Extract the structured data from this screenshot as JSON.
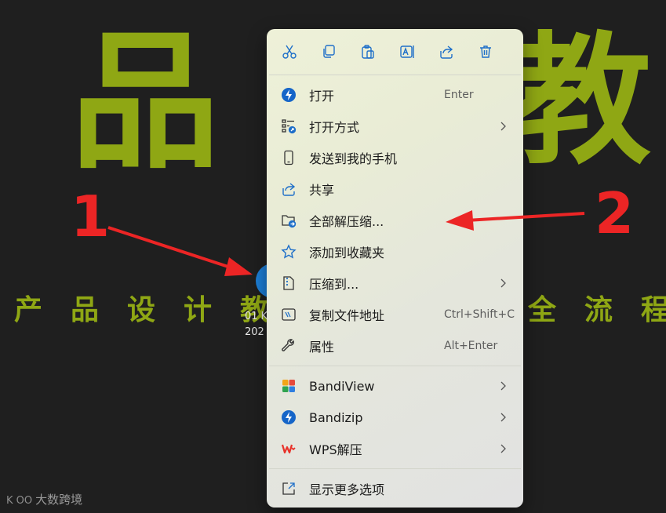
{
  "background": {
    "big_left": "品",
    "big_right": "教",
    "subtitle_left": [
      "产",
      "品",
      "设",
      "计",
      "教"
    ],
    "subtitle_right": [
      "全",
      "流",
      "程"
    ],
    "file_name_line1": "01 K",
    "file_name_line2": "202",
    "num_1": "1",
    "num_2": "2",
    "watermark": "大数跨境",
    "watermark_logo": "K OO"
  },
  "menu": {
    "toolbar": [
      {
        "name": "cut-icon"
      },
      {
        "name": "copy-icon"
      },
      {
        "name": "paste-icon"
      },
      {
        "name": "rename-icon"
      },
      {
        "name": "share-icon"
      },
      {
        "name": "delete-icon"
      }
    ],
    "items": [
      {
        "label": "打开",
        "shortcut": "Enter"
      },
      {
        "label": "打开方式"
      },
      {
        "label": "发送到我的手机"
      },
      {
        "label": "共享"
      },
      {
        "label": "全部解压缩..."
      },
      {
        "label": "添加到收藏夹"
      },
      {
        "label": "压缩到..."
      },
      {
        "label": "复制文件地址",
        "shortcut": "Ctrl+Shift+C"
      },
      {
        "label": "属性",
        "shortcut": "Alt+Enter"
      },
      {
        "label": "BandiView"
      },
      {
        "label": "Bandizip"
      },
      {
        "label": "WPS解压"
      },
      {
        "label": "显示更多选项"
      }
    ]
  },
  "colors": {
    "accent_green": "#8fa714",
    "arrow_red": "#ec2525",
    "menu_blue": "#1e6fc9"
  }
}
